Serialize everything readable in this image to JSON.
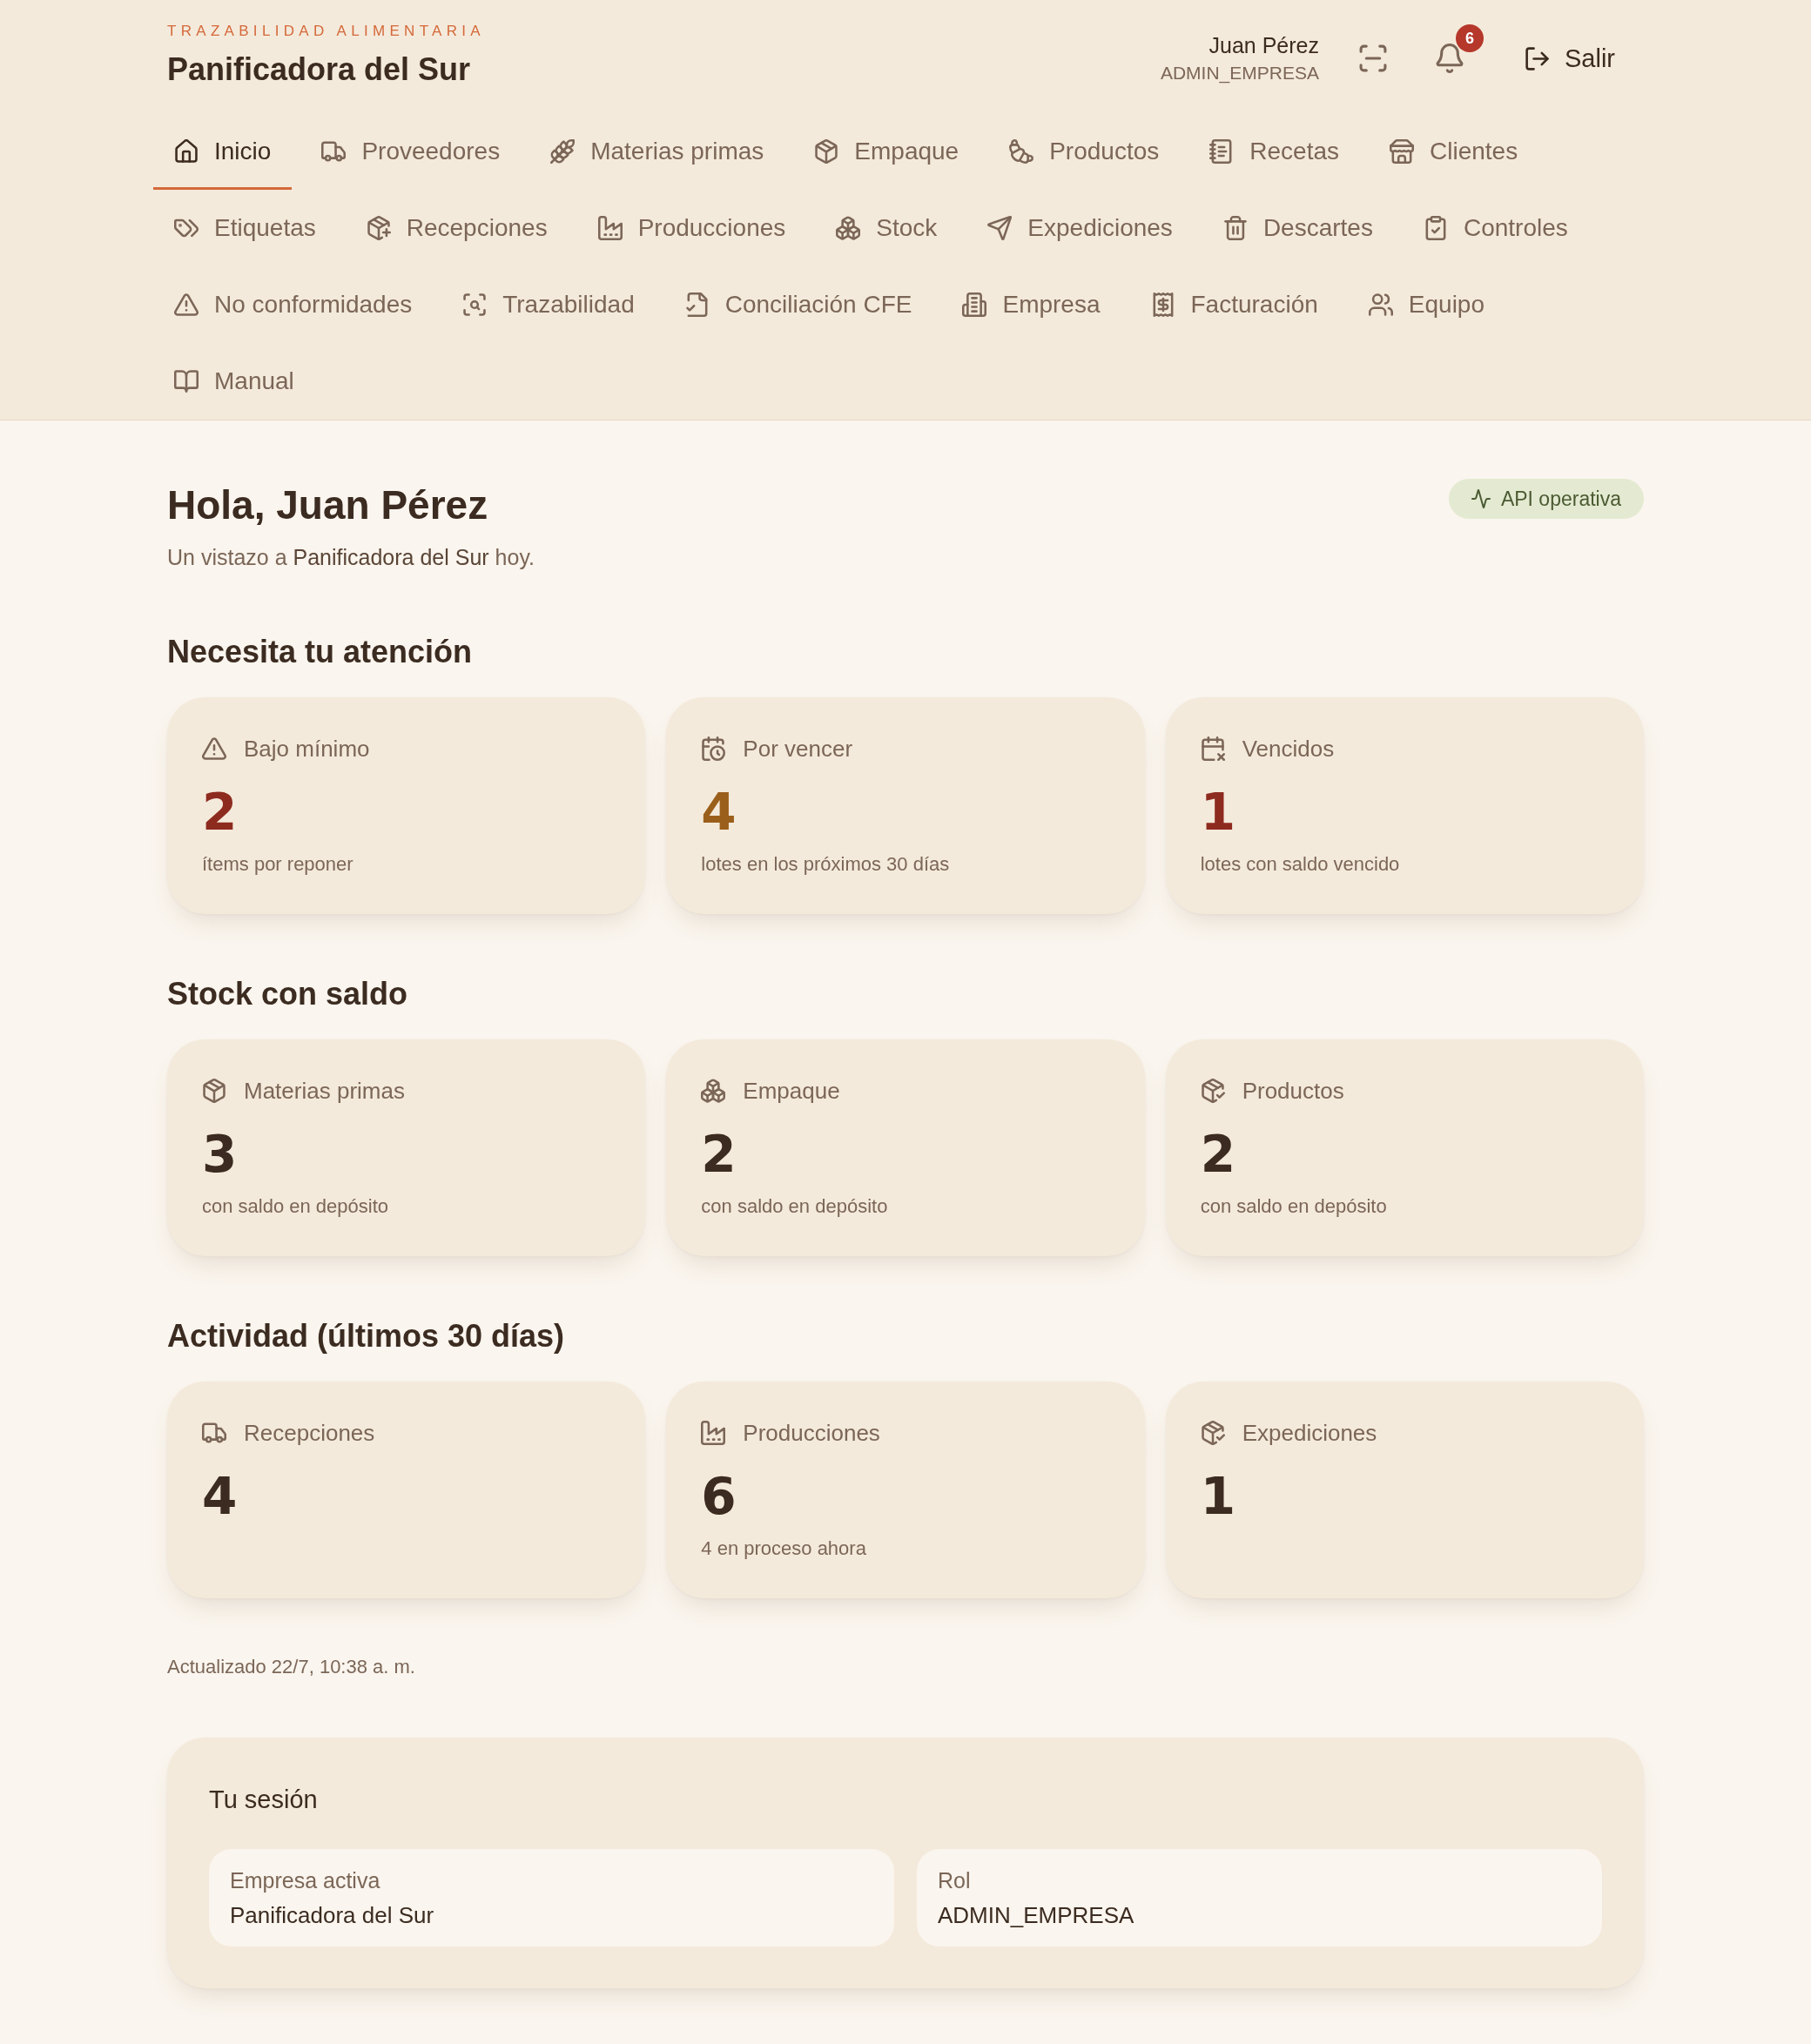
{
  "header": {
    "tagline": "TRAZABILIDAD ALIMENTARIA",
    "company": "Panificadora del Sur",
    "user": {
      "name": "Juan Pérez",
      "role": "ADMIN_EMPRESA"
    },
    "notifications": {
      "count": "6"
    },
    "logout": {
      "label": "Salir"
    }
  },
  "nav": {
    "items": [
      {
        "label": "Inicio",
        "selected": true
      },
      {
        "label": "Proveedores",
        "selected": false
      },
      {
        "label": "Materias primas",
        "selected": false
      },
      {
        "label": "Empaque",
        "selected": false
      },
      {
        "label": "Productos",
        "selected": false
      },
      {
        "label": "Recetas",
        "selected": false
      },
      {
        "label": "Clientes",
        "selected": false
      },
      {
        "label": "Etiquetas",
        "selected": false
      },
      {
        "label": "Recepciones",
        "selected": false
      },
      {
        "label": "Producciones",
        "selected": false
      },
      {
        "label": "Stock",
        "selected": false
      },
      {
        "label": "Expediciones",
        "selected": false
      },
      {
        "label": "Descartes",
        "selected": false
      },
      {
        "label": "Controles",
        "selected": false
      },
      {
        "label": "No conformidades",
        "selected": false
      },
      {
        "label": "Trazabilidad",
        "selected": false
      },
      {
        "label": "Conciliación CFE",
        "selected": false
      },
      {
        "label": "Empresa",
        "selected": false
      },
      {
        "label": "Facturación",
        "selected": false
      },
      {
        "label": "Equipo",
        "selected": false
      },
      {
        "label": "Manual",
        "selected": false
      }
    ]
  },
  "greeting": {
    "title": "Hola, Juan Pérez",
    "subtitle": "Un vistazo a **Panificadora del Sur** hoy.",
    "status": {
      "label": "API operativa"
    }
  },
  "sections": [
    {
      "title": "Necesita tu atención",
      "cards": [
        {
          "label": "Bajo mínimo",
          "value": "2",
          "color": "#8e2b1f",
          "note": "ítems por reponer"
        },
        {
          "label": "Por vencer",
          "value": "4",
          "color": "#9b5f1c",
          "note": "lotes en los próximos 30 días"
        },
        {
          "label": "Vencidos",
          "value": "1",
          "color": "#8e2b1f",
          "note": "lotes con saldo vencido"
        }
      ]
    },
    {
      "title": "Stock con saldo",
      "cards": [
        {
          "label": "Materias primas",
          "value": "3",
          "note": "con saldo en depósito"
        },
        {
          "label": "Empaque",
          "value": "2",
          "note": "con saldo en depósito"
        },
        {
          "label": "Productos",
          "value": "2",
          "note": "con saldo en depósito"
        }
      ]
    },
    {
      "title": "Actividad (últimos 30 días)",
      "cards": [
        {
          "label": "Recepciones",
          "value": "4"
        },
        {
          "label": "Producciones",
          "value": "6",
          "note": "4 en proceso ahora"
        },
        {
          "label": "Expediciones",
          "value": "1"
        }
      ]
    }
  ],
  "updated": "Actualizado 22/7, 10:38 a. m.",
  "session": {
    "title": "Tu sesión",
    "fields": [
      {
        "label": "Empresa activa",
        "value": "Panificadora del Sur"
      },
      {
        "label": "Rol",
        "value": "ADMIN_EMPRESA"
      }
    ]
  }
}
